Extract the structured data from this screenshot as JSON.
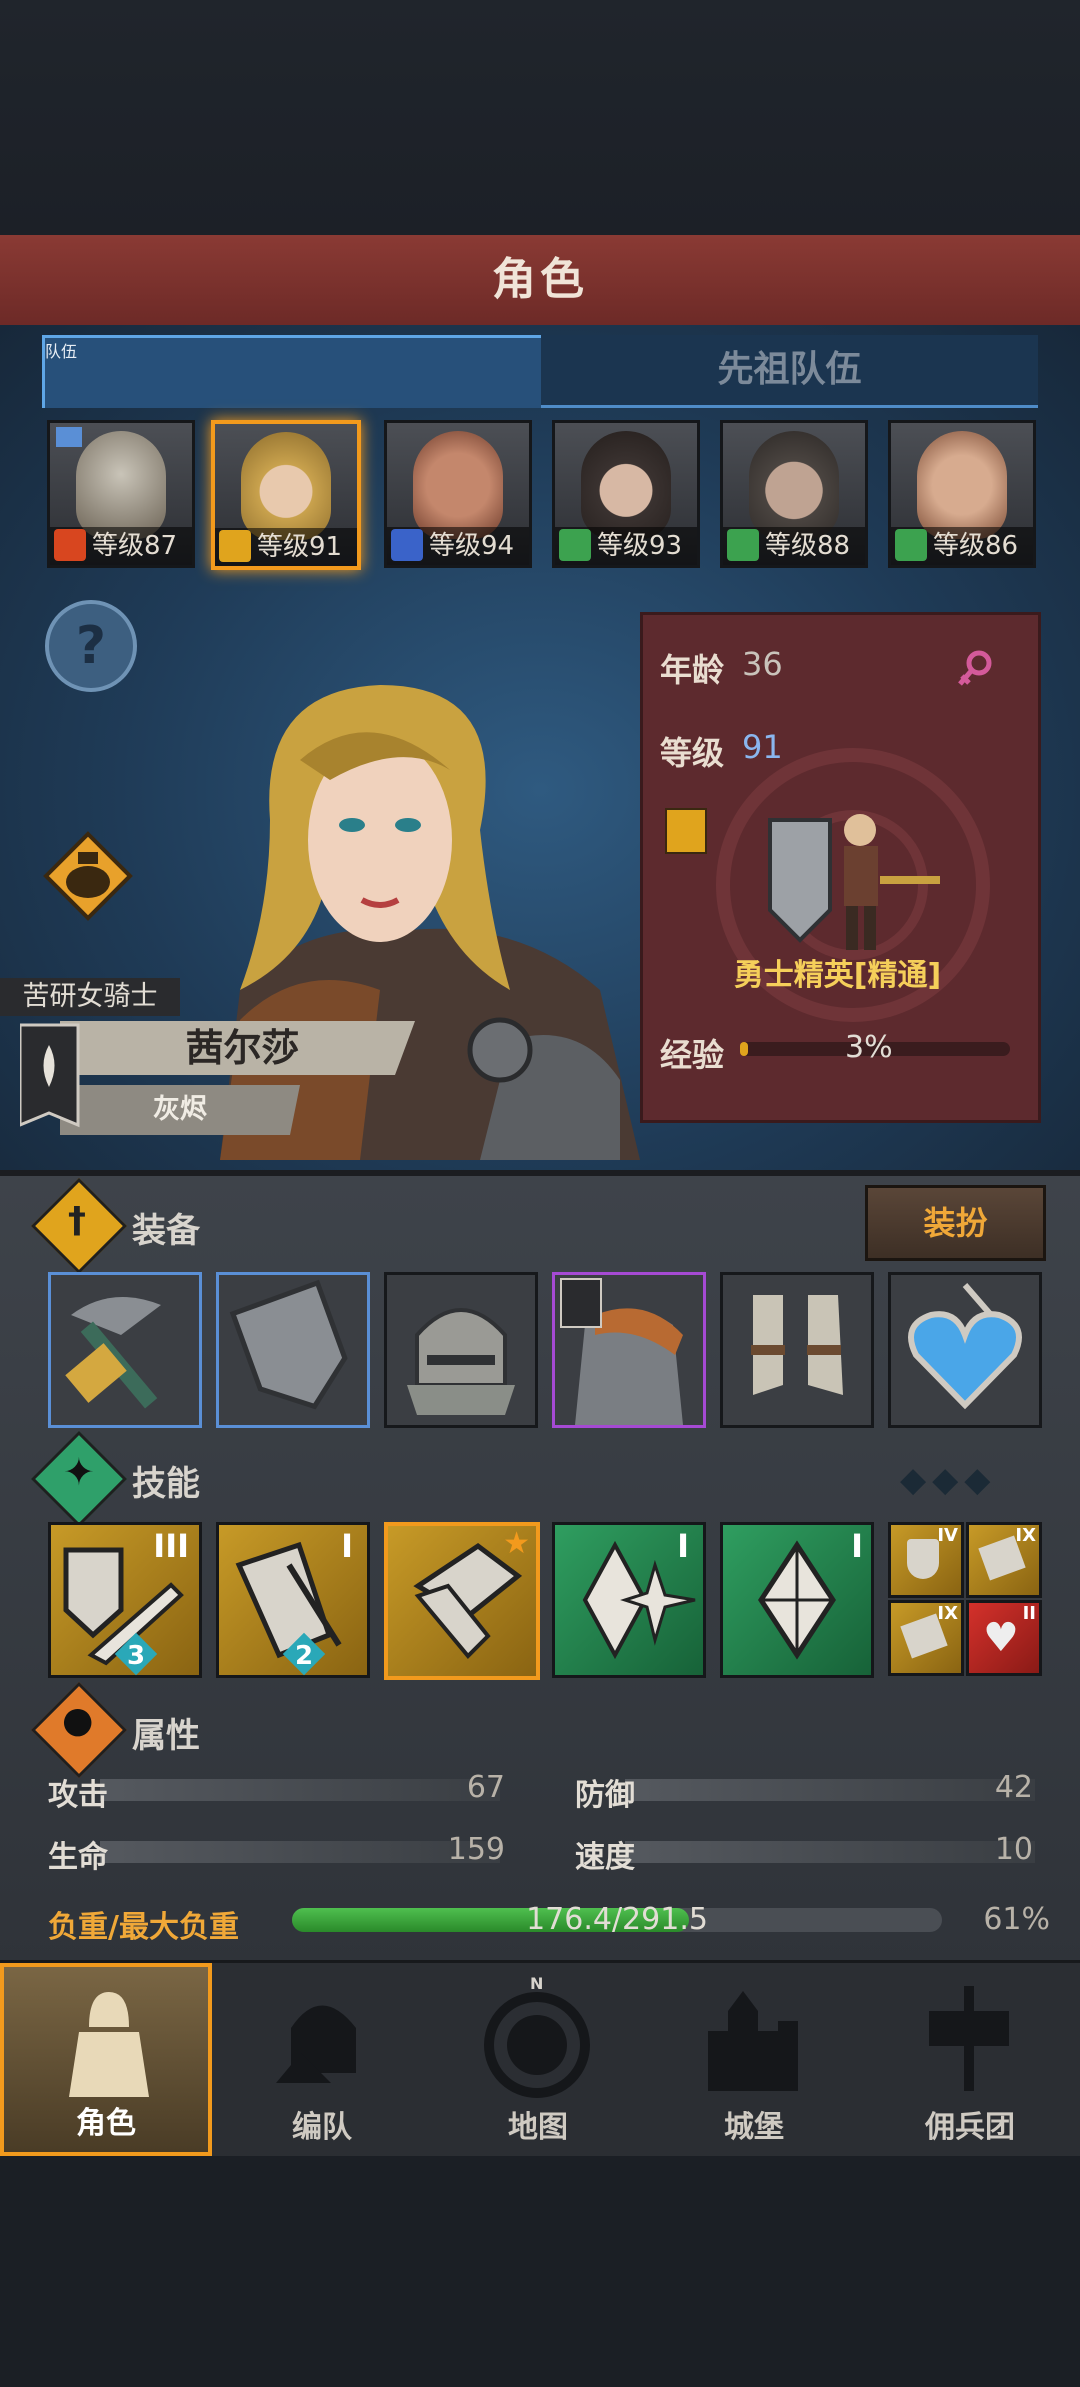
{
  "header": {
    "title": "角色"
  },
  "tabs": [
    {
      "label": "队伍",
      "active": true
    },
    {
      "label": "先祖队伍",
      "active": false
    }
  ],
  "roster": [
    {
      "level_text": "等级87",
      "class_color": "#d8461f",
      "selected": false
    },
    {
      "level_text": "等级91",
      "class_color": "#e0a41d",
      "selected": true
    },
    {
      "level_text": "等级94",
      "class_color": "#3a63c9",
      "selected": false
    },
    {
      "level_text": "等级93",
      "class_color": "#3ca24f",
      "selected": false
    },
    {
      "level_text": "等级88",
      "class_color": "#3ca24f",
      "selected": false
    },
    {
      "level_text": "等级86",
      "class_color": "#3ca24f",
      "selected": false
    }
  ],
  "character": {
    "title": "苦研女骑士",
    "name": "茜尔莎",
    "faction": "灰烬",
    "age_label": "年龄",
    "age": "36",
    "level_label": "等级",
    "level": "91",
    "class_name": "勇士精英[精通]",
    "exp_label": "经验",
    "exp_value": "3%",
    "exp_fraction": 0.03,
    "gender_icon": "female-icon"
  },
  "equipment": {
    "title": "装备",
    "outfit_button": "装扮",
    "slots": [
      "pickaxe-weapon",
      "shield",
      "helmet",
      "armor",
      "boots",
      "amulet"
    ]
  },
  "skills": {
    "title": "技能",
    "items": [
      {
        "icon": "shield-sword-skill",
        "rank": "III",
        "badge": "3"
      },
      {
        "icon": "shield-bash-skill",
        "rank": "I",
        "badge": "2"
      },
      {
        "icon": "shield-strike-skill",
        "rank": "",
        "badge": ""
      },
      {
        "icon": "burst-skill",
        "rank": "I",
        "badge": ""
      },
      {
        "icon": "crystal-skill",
        "rank": "I",
        "badge": ""
      }
    ],
    "mini": [
      {
        "rank": "IV"
      },
      {
        "rank": "IX"
      },
      {
        "rank": "IX"
      },
      {
        "rank": "II"
      }
    ]
  },
  "attributes": {
    "title": "属性",
    "attack_label": "攻击",
    "attack": "67",
    "defense_label": "防御",
    "defense": "42",
    "hp_label": "生命",
    "hp": "159",
    "speed_label": "速度",
    "speed": "10",
    "load_label": "负重/最大负重",
    "load_text": "176.4/291.5",
    "load_percent": "61%",
    "load_fraction": 0.61
  },
  "nav": [
    {
      "label": "角色",
      "active": true
    },
    {
      "label": "编队",
      "active": false
    },
    {
      "label": "地图",
      "active": false
    },
    {
      "label": "城堡",
      "active": false
    },
    {
      "label": "佣兵团",
      "active": false
    }
  ],
  "colors": {
    "accent": "#f29a1d",
    "title_bar": "#8a3a34",
    "panel_blue": "#2f5a80",
    "card": "#5d2a2e"
  }
}
